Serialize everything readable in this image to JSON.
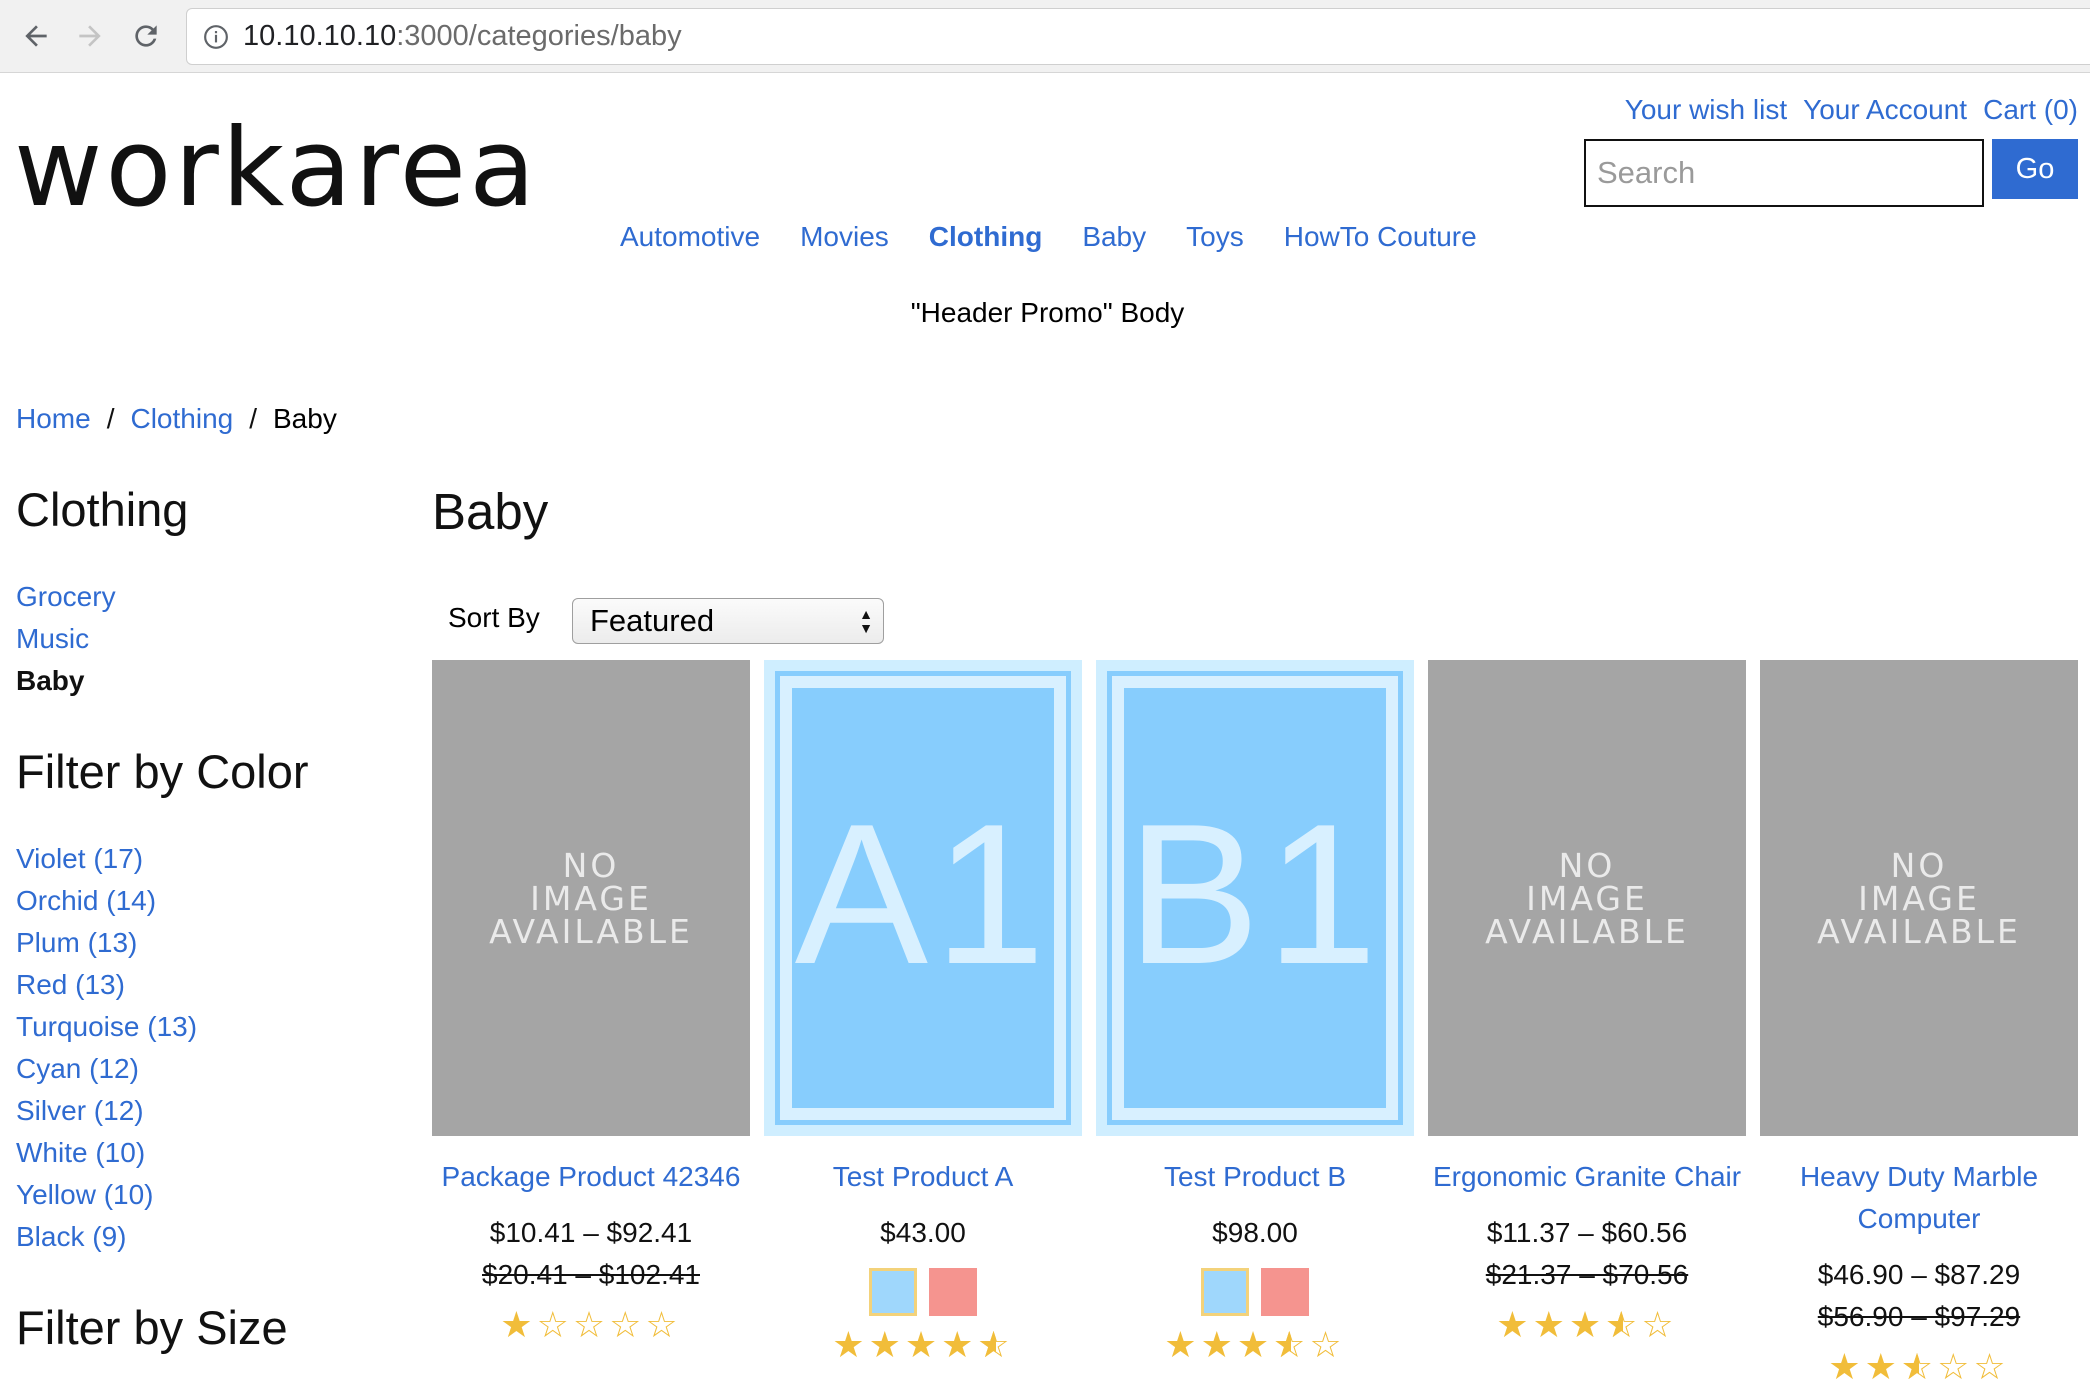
{
  "browser": {
    "url_host": "10.10.10.10",
    "url_rest": ":3000/categories/baby"
  },
  "header": {
    "logo": "workarea",
    "utility": [
      "Your wish list",
      "Your Account",
      "Cart (0)"
    ],
    "search_placeholder": "Search",
    "go_label": "Go",
    "nav": [
      {
        "label": "Automotive",
        "active": false
      },
      {
        "label": "Movies",
        "active": false
      },
      {
        "label": "Clothing",
        "active": true
      },
      {
        "label": "Baby",
        "active": false
      },
      {
        "label": "Toys",
        "active": false
      },
      {
        "label": "HowTo Couture",
        "active": false
      }
    ],
    "promo": "\"Header Promo\" Body"
  },
  "breadcrumb": {
    "items": [
      "Home",
      "Clothing",
      "Baby"
    ],
    "separator": "/"
  },
  "sidebar": {
    "category_heading": "Clothing",
    "categories": [
      "Grocery",
      "Music",
      "Baby"
    ],
    "current_category": "Baby",
    "color_heading": "Filter by Color",
    "colors": [
      "Violet (17)",
      "Orchid (14)",
      "Plum (13)",
      "Red (13)",
      "Turquoise (13)",
      "Cyan (12)",
      "Silver (12)",
      "White (10)",
      "Yellow (10)",
      "Black (9)"
    ],
    "size_heading": "Filter by Size"
  },
  "main": {
    "title": "Baby",
    "sort_label": "Sort By",
    "sort_value": "Featured",
    "no_image_text": [
      "NO",
      "IMAGE",
      "AVAILABLE"
    ],
    "products": [
      {
        "name": "Package Product 42346",
        "image": "none",
        "price": "$10.41 – $92.41",
        "original": "$20.41 – $102.41",
        "rating": 1,
        "swatches": []
      },
      {
        "name": "Test Product A",
        "image": "A1",
        "price": "$43.00",
        "original": "",
        "rating": 4.5,
        "swatches": [
          "#9fd7fc",
          "#f5948f"
        ]
      },
      {
        "name": "Test Product B",
        "image": "B1",
        "price": "$98.00",
        "original": "",
        "rating": 3.5,
        "swatches": [
          "#9fd7fc",
          "#f5948f"
        ]
      },
      {
        "name": "Ergonomic Granite Chair",
        "image": "none",
        "price": "$11.37 – $60.56",
        "original": "$21.37 – $70.56",
        "rating": 3.5,
        "swatches": []
      },
      {
        "name": "Heavy Duty Marble Computer",
        "image": "none",
        "price": "$46.90 – $87.29",
        "original": "$56.90 – $97.29",
        "rating": 2.5,
        "swatches": []
      }
    ]
  },
  "colors": {
    "link": "#2f6bd1",
    "star": "#f1bd3a",
    "no_image_bg": "#a5a5a5",
    "code_image_bg": "#87cdfd"
  }
}
